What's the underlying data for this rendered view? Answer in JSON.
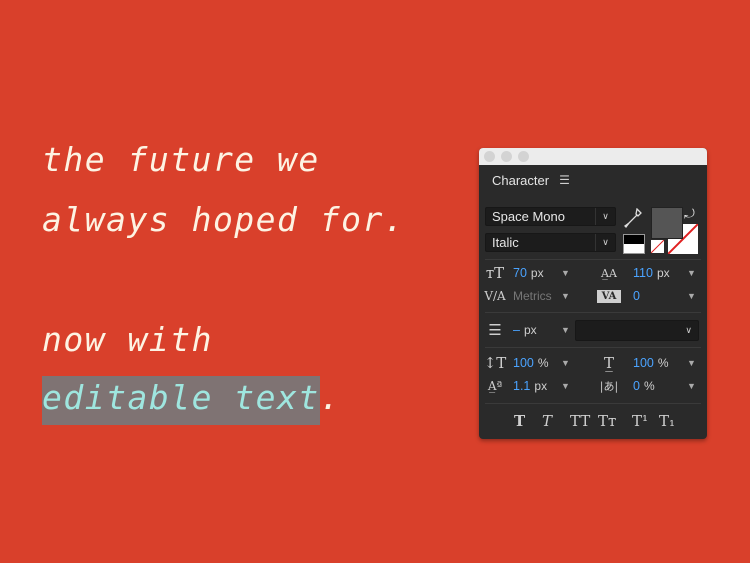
{
  "hero": {
    "line1": "the future we",
    "line2": "always hoped for.",
    "line3": "now with",
    "line4_selected": "editable text",
    "line4_tail": "."
  },
  "colors": {
    "background": "#d9402b",
    "text": "#fdf3e3",
    "selection_bg": "#7f7373",
    "selection_text": "#9fe6df",
    "panel_bg": "#2a2a2a",
    "value_blue": "#4aa3ff"
  },
  "panel": {
    "title": "Character",
    "menu_icon": "hamburger-menu-icon",
    "font_family": "Space Mono",
    "font_style": "Italic",
    "font_size": {
      "value": "70",
      "unit": "px"
    },
    "leading": {
      "value": "110",
      "unit": "px"
    },
    "kerning": {
      "value": "Metrics"
    },
    "tracking": {
      "value": "0"
    },
    "stroke_width": {
      "value": "–",
      "unit": "px"
    },
    "stroke_style": "",
    "vertical_scale": {
      "value": "100",
      "unit": "%"
    },
    "horizontal_scale": {
      "value": "100",
      "unit": "%"
    },
    "baseline_shift": {
      "value": "1.1",
      "unit": "px"
    },
    "tsume": {
      "value": "0",
      "unit": "%"
    },
    "style_buttons": [
      "Faux Bold",
      "Faux Italic",
      "All Caps",
      "Small Caps",
      "Superscript",
      "Subscript"
    ]
  }
}
